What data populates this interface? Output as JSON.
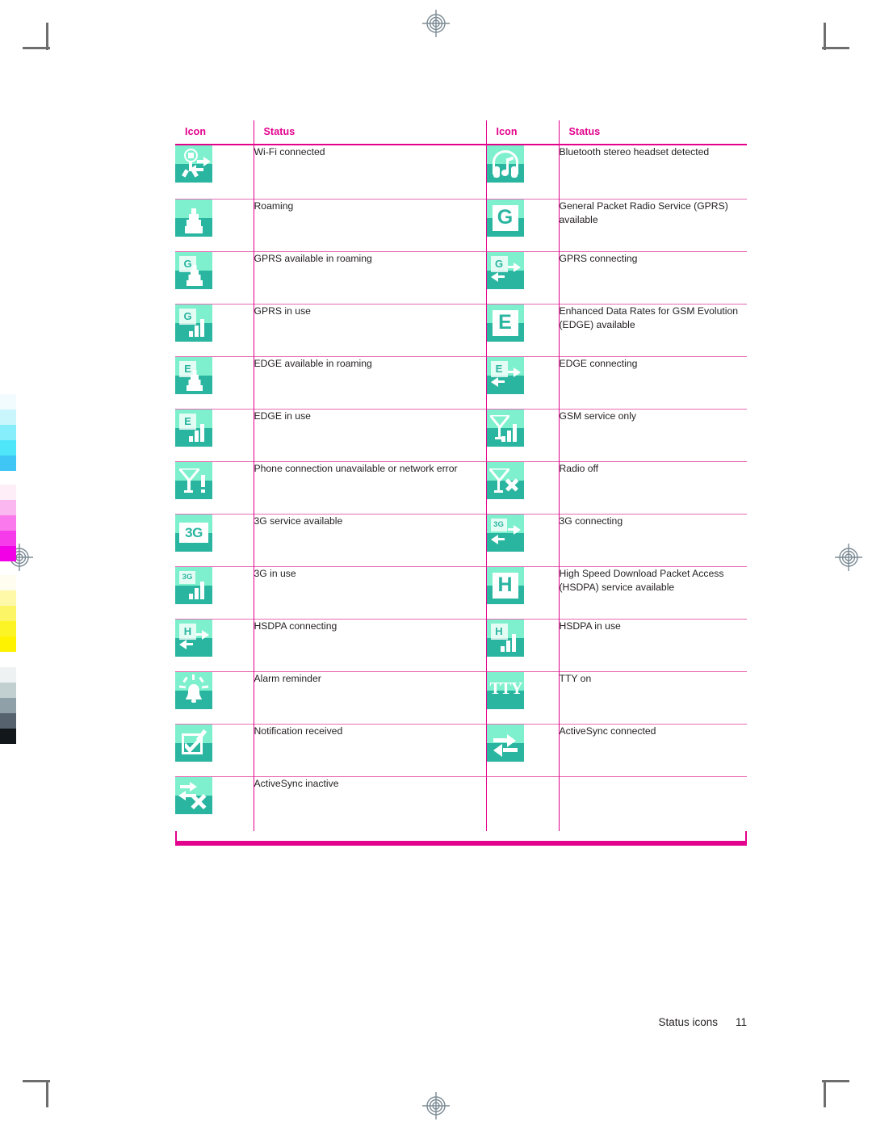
{
  "document": {
    "footer_label": "Status icons",
    "footer_page_number": "11"
  },
  "colors": {
    "table_border_magenta": "#e3008c",
    "table_border_light": "#e86bb4",
    "header_text": "#e3008c",
    "icon_light_teal": "#7ef0cd",
    "icon_dark_teal": "#2ab5a0",
    "body_text": "#231f20"
  },
  "table": {
    "headers": [
      "Icon",
      "Status",
      "Icon",
      "Status"
    ],
    "rows": [
      {
        "left": {
          "icon": "wifi-connected-icon",
          "status": "Wi-Fi connected"
        },
        "right": {
          "icon": "bluetooth-stereo-headset-icon",
          "status": "Bluetooth stereo headset detected"
        }
      },
      {
        "left": {
          "icon": "roaming-tower-icon",
          "status": "Roaming"
        },
        "right": {
          "icon": "gprs-available-icon",
          "status": "General Packet Radio Service (GPRS) available"
        }
      },
      {
        "left": {
          "icon": "gprs-roaming-icon",
          "status": "GPRS available in roaming"
        },
        "right": {
          "icon": "gprs-connecting-icon",
          "status": "GPRS connecting"
        }
      },
      {
        "left": {
          "icon": "gprs-in-use-icon",
          "status": "GPRS in use"
        },
        "right": {
          "icon": "edge-available-icon",
          "status": "Enhanced Data Rates for GSM Evolution (EDGE) available"
        }
      },
      {
        "left": {
          "icon": "edge-roaming-icon",
          "status": "EDGE available in roaming"
        },
        "right": {
          "icon": "edge-connecting-icon",
          "status": "EDGE connecting"
        }
      },
      {
        "left": {
          "icon": "edge-in-use-icon",
          "status": "EDGE in use"
        },
        "right": {
          "icon": "gsm-service-only-icon",
          "status": "GSM service only"
        }
      },
      {
        "left": {
          "icon": "phone-connection-error-icon",
          "status": "Phone connection unavailable or network error"
        },
        "right": {
          "icon": "radio-off-icon",
          "status": "Radio off"
        }
      },
      {
        "left": {
          "icon": "3g-service-available-icon",
          "status": "3G service available"
        },
        "right": {
          "icon": "3g-connecting-icon",
          "status": "3G connecting"
        }
      },
      {
        "left": {
          "icon": "3g-in-use-icon",
          "status": "3G in use"
        },
        "right": {
          "icon": "hsdpa-available-icon",
          "status": "High Speed Download Packet Access (HSDPA) service available"
        }
      },
      {
        "left": {
          "icon": "hsdpa-connecting-icon",
          "status": "HSDPA connecting"
        },
        "right": {
          "icon": "hsdpa-in-use-icon",
          "status": "HSDPA in use"
        }
      },
      {
        "left": {
          "icon": "alarm-reminder-icon",
          "status": "Alarm reminder"
        },
        "right": {
          "icon": "tty-on-icon",
          "status": "TTY on"
        }
      },
      {
        "left": {
          "icon": "notification-received-icon",
          "status": "Notification received"
        },
        "right": {
          "icon": "activesync-connected-icon",
          "status": "ActiveSync connected"
        }
      },
      {
        "left": {
          "icon": "activesync-inactive-icon",
          "status": "ActiveSync inactive"
        },
        "right": {
          "icon": "",
          "status": ""
        }
      }
    ]
  },
  "icon_glyphs": {
    "gprs_letter": "G",
    "edge_letter": "E",
    "hsdpa_letter": "H",
    "threeg_letter": "3G",
    "tty_letter": "TTY"
  },
  "calibration_bars": {
    "cyan": [
      "#f2fcfe",
      "#c8f6fc",
      "#86eefb",
      "#4fe6fa",
      "#3fc6f4"
    ],
    "magenta": [
      "#fdeef8",
      "#fbb8f0",
      "#fa79ec",
      "#f63bea",
      "#f200e6"
    ],
    "yellow": [
      "#fffdf0",
      "#fdf9a8",
      "#fcf566",
      "#fdf426",
      "#fff200"
    ],
    "grayscale": [
      "#eff2f3",
      "#c3d0d2",
      "#90a0a9",
      "#56636f",
      "#12171c"
    ]
  }
}
